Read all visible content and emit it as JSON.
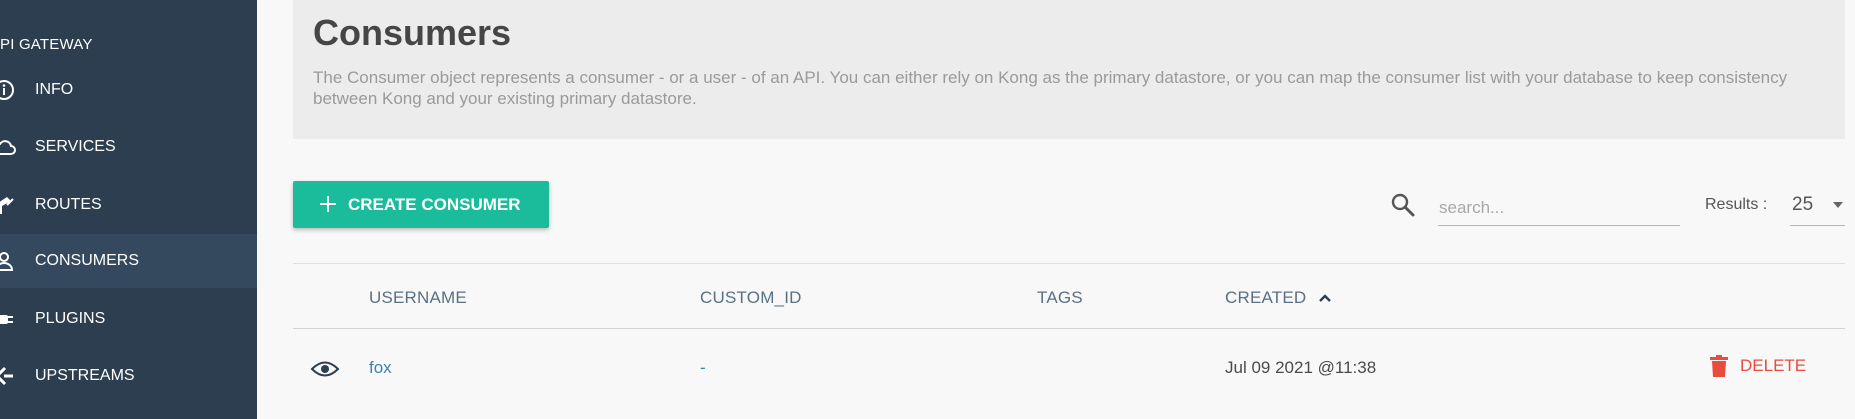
{
  "sidebar": {
    "heading": "PI GATEWAY",
    "items": [
      {
        "label": "INFO",
        "icon": "info-icon"
      },
      {
        "label": "SERVICES",
        "icon": "cloud-icon"
      },
      {
        "label": "ROUTES",
        "icon": "route-icon"
      },
      {
        "label": "CONSUMERS",
        "icon": "user-icon",
        "active": true
      },
      {
        "label": "PLUGINS",
        "icon": "plug-icon"
      },
      {
        "label": "UPSTREAMS",
        "icon": "upstream-icon"
      }
    ]
  },
  "header": {
    "title": "Consumers",
    "description": "The Consumer object represents a consumer - or a user - of an API. You can either rely on Kong as the primary datastore, or you can map the consumer list with your database to keep consistency between Kong and your existing primary datastore."
  },
  "toolbar": {
    "create_label": "CREATE CONSUMER",
    "search_placeholder": "search...",
    "search_value": "",
    "results_label": "Results :",
    "results_value": "25"
  },
  "table": {
    "headers": {
      "username": "USERNAME",
      "custom_id": "CUSTOM_ID",
      "tags": "TAGS",
      "created": "CREATED"
    },
    "sort": {
      "column": "created",
      "direction": "ascending"
    },
    "rows": [
      {
        "username": "fox",
        "custom_id": "-",
        "tags": "",
        "created": "Jul 09 2021 @11:38",
        "delete_label": "DELETE"
      }
    ]
  },
  "colors": {
    "sidebar_bg": "#2c3e50",
    "sidebar_active": "#34495e",
    "accent": "#1abc9c",
    "link": "#3b82b8",
    "danger": "#e74c3c"
  }
}
